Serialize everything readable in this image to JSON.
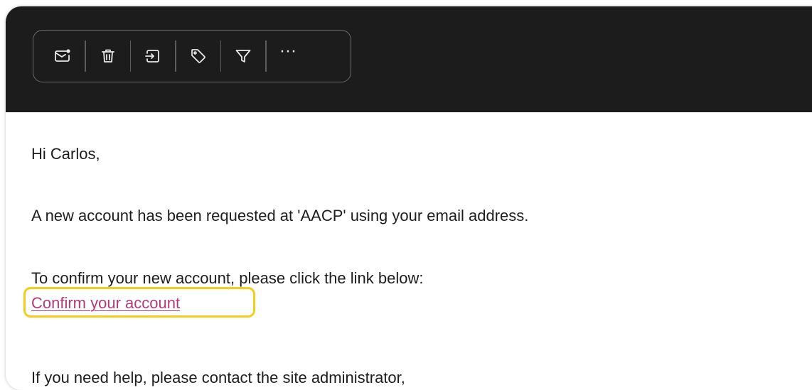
{
  "toolbar": {
    "buttons": [
      {
        "icon": "mark-unread-icon"
      },
      {
        "icon": "trash-icon"
      },
      {
        "icon": "move-to-icon"
      },
      {
        "icon": "tag-icon"
      },
      {
        "icon": "filter-icon"
      },
      {
        "icon": "more-icon",
        "label": "···"
      }
    ]
  },
  "email": {
    "greeting": "Hi Carlos,",
    "paragraph1": "A new account has been requested at 'AACP' using your email address.",
    "paragraph2": "To confirm your new account, please click the link below:",
    "link_label": "Confirm your account",
    "paragraph3": "If you need help, please contact the site administrator,"
  },
  "colors": {
    "topbar": "#1c1c1c",
    "link": "#b03b76",
    "highlight": "#f5cc1c"
  }
}
